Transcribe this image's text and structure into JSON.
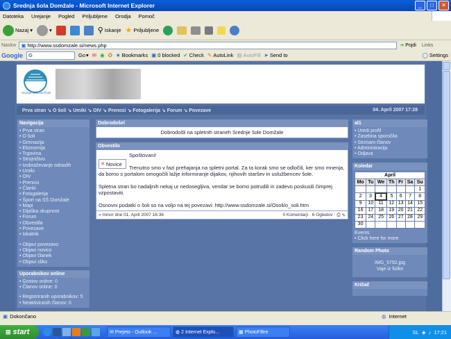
{
  "window": {
    "title": "Srednja šola Domžale - Microsoft Internet Explorer",
    "minimize": "_",
    "maximize": "□",
    "close": "✕"
  },
  "menu": [
    "Datoteka",
    "Urejanje",
    "Pogled",
    "Priljubljene",
    "Orodja",
    "Pomoč"
  ],
  "toolbar": {
    "back": "Nazaj",
    "search": "Iskanje",
    "favorites": "Priljubljene"
  },
  "address": {
    "label": "Naslov",
    "url": "http://www.ssdomzale.si/news.php",
    "go": "Pojdi",
    "links": "Links"
  },
  "googlebar": {
    "logo": "Google",
    "input_value": "G",
    "go": "Go",
    "bookmarks": "Bookmarks",
    "blocked": "0 blocked",
    "check": "Check",
    "autolink": "AutoLink",
    "autofill": "AutoFill",
    "sendto": "Send to",
    "settings": "Settings"
  },
  "site": {
    "logo_text": "srednja šola domžale",
    "nav": "Prva stran ↘ O šoli ↘ Umiki ↘ OIV ↘ Prenosi ↘ Fotogalerija ↘ Forum ↘ Povezave",
    "date": "04. April 2007 17:28",
    "navigation": {
      "title": "Navigacija",
      "items": [
        "Prva stran",
        "O šoli",
        "Gimnazija",
        "Ekonomija",
        "Trgovina",
        "Strojništvo",
        "Izobraževanje odraslih",
        "Umiki",
        "OIV",
        "Prenosi",
        "Članki",
        "Fotogalerija",
        "Šport na SŠ Domžale",
        "Mapi",
        "Dijaška skupnost",
        "Forum",
        "Obvestila",
        "Povezave",
        "Iskalnik"
      ],
      "submit_items": [
        "Objavi povezavo",
        "Objavi novico",
        "Objavi članek",
        "Objavi sliko"
      ]
    },
    "users_online": {
      "title": "Uporabnikov online",
      "guests": "Gostov online: 0",
      "members": "Članov online: 0",
      "registered": "Registriranih uporabnikov: 5",
      "unactivated": "Neaktiviranih članov: 0"
    },
    "welcome": {
      "title": "Dobrodošel",
      "text": "Dobrodošli na spletnih straneh Srednje šole Domžale"
    },
    "news": {
      "title": "Obvestilo",
      "tag": "Novice",
      "greeting": "Spoštovani!",
      "p1": "Trenutno smo v fazi prehajanja na spletni portal. Za ta korak smo se odločili, ker smo mnenja, da bomo s portalom omogočili lažje informiranje dijakov, njihovih staršev in uslužbencev šole.",
      "p2": "Spletna stran bo nadaljnih nekaj ur nedosegljiva, vendar se bomo potrudili in zadevo poskusili čimprej vzpostaviti.",
      "p3": "Osnovni podatki o šoli so na voljo na tej povezavi: http://www.ssdomzale.si/Osoli/o_soli.htm",
      "footer_left": "» minor dne 01. April 2007 16:36",
      "footer_right": "0 Komentarji · 6 Ogledov ·"
    },
    "user_panel": {
      "title": "al1",
      "items": [
        "Uredi profil",
        "Zasebna sporočila",
        "Seznam članov",
        "Administracija",
        "Odjava"
      ]
    },
    "calendar": {
      "title": "Koledar",
      "month": "April",
      "days": [
        "Mo",
        "Tu",
        "We",
        "Th",
        "Fr",
        "Sa",
        "Su"
      ],
      "weeks": [
        [
          "",
          "",
          "",
          "",
          "",
          "",
          "1"
        ],
        [
          "2",
          "3",
          "4",
          "5",
          "6",
          "7",
          "8"
        ],
        [
          "9",
          "10",
          "11",
          "12",
          "13",
          "14",
          "15"
        ],
        [
          "16",
          "17",
          "18",
          "19",
          "20",
          "21",
          "22"
        ],
        [
          "23",
          "24",
          "25",
          "26",
          "27",
          "28",
          "29"
        ],
        [
          "30",
          "",
          "",
          "",
          "",
          "",
          ""
        ]
      ],
      "events_label": "Events",
      "events_link": "Click here for more"
    },
    "random_photo": {
      "title": "Random Photo",
      "filename": "IMG_5792.jpg",
      "caption": "Vaje iz fizike"
    },
    "shoutbox": {
      "title": "Kričač"
    }
  },
  "status": {
    "text": "Dokončano",
    "zone": "Internet"
  },
  "taskbar": {
    "start": "start",
    "tasks": [
      "Prejeto - Outlook ...",
      "2 Internet Explo...",
      "PhotoFiltre"
    ],
    "lang": "SL",
    "clock": "17:21"
  }
}
